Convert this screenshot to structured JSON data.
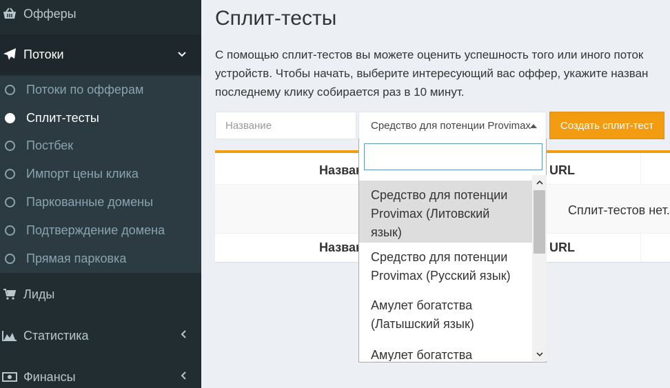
{
  "sidebar": {
    "offers_label": "Офферы",
    "flows_label": "Потоки",
    "submenu": [
      {
        "label": "Потоки по офферам",
        "active": false
      },
      {
        "label": "Сплит-тесты",
        "active": true
      },
      {
        "label": "Постбек",
        "active": false
      },
      {
        "label": "Импорт цены клика",
        "active": false
      },
      {
        "label": "Паркованные домены",
        "active": false
      },
      {
        "label": "Подтверждение домена",
        "active": false
      },
      {
        "label": "Прямая парковка",
        "active": false
      }
    ],
    "leads_label": "Лиды",
    "stats_label": "Статистика",
    "finance_label": "Финансы"
  },
  "main": {
    "title": "Сплит-тесты",
    "description_lines": [
      "С помощью сплит-тестов вы можете оценить успешность того или иного поток",
      "устройств. Чтобы начать, выберите интересующий вас оффер, укажите назван",
      "последнему клику собирается раз в 10 минут."
    ],
    "name_placeholder": "Название",
    "selected_offer": "Средство для потенции Provimax (Литовский язык)",
    "create_button": "Создать сплит-тест",
    "table": {
      "header_name": "Назван",
      "header_url": "URL",
      "empty_text": "Сплит-тестов нет."
    }
  },
  "dropdown": {
    "search_value": "",
    "options": [
      "Средство для потенции Provimax (Литовский язык)",
      "Средство для потенции Provimax (Русский язык)",
      "Амулет богатства (Латышский язык)",
      "Амулет богатства"
    ],
    "highlighted_index": 0
  },
  "colors": {
    "sidebar_bg": "#222d32",
    "submenu_bg": "#2c3b41",
    "accent": "#f39c12"
  }
}
